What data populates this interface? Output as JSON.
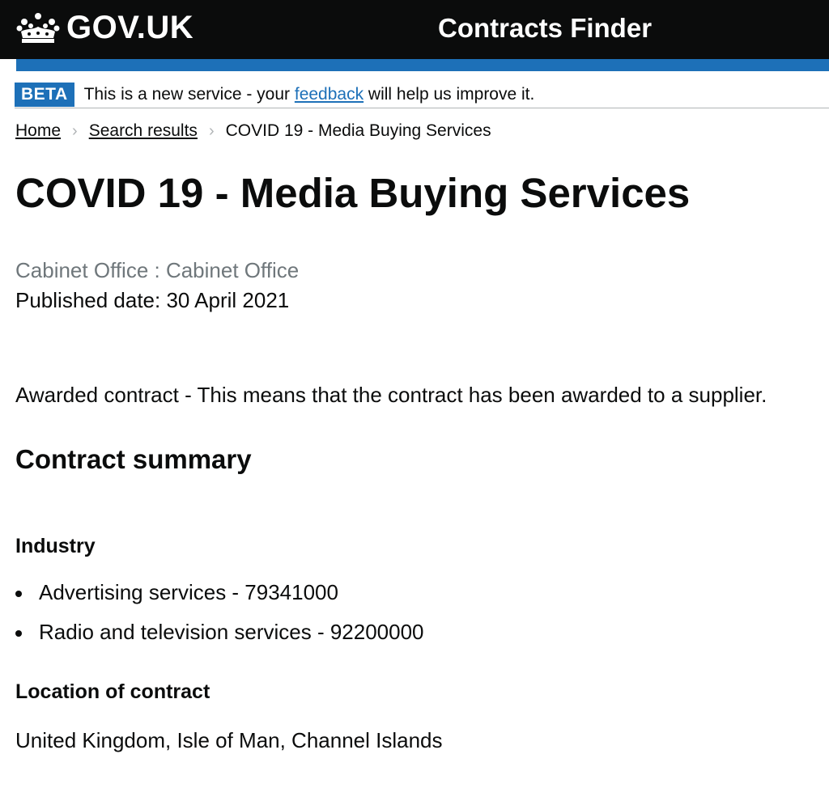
{
  "header": {
    "logo_text": "GOV.UK",
    "service_name": "Contracts Finder",
    "brand_color": "#0b0c0c",
    "accent_color": "#1d70b8",
    "logo_icon": "crown-icon"
  },
  "beta_banner": {
    "tag": "BETA",
    "text_before": "This is a new service - your ",
    "link": "feedback",
    "text_after": " will help us improve it."
  },
  "breadcrumbs": {
    "home": "Home",
    "search_results": "Search results",
    "current": "COVID 19 - Media Buying Services",
    "separator_icon": "chevron-right-icon"
  },
  "page": {
    "title": "COVID 19 - Media Buying Services",
    "organisation": "Cabinet Office : Cabinet Office",
    "published_date": "Published date: 30 April 2021",
    "awarded_notice": "Awarded contract - This means that the contract has been awarded to a supplier."
  },
  "summary": {
    "heading": "Contract summary",
    "industry_heading": "Industry",
    "industry_items": [
      "Advertising services - 79341000",
      "Radio and television services - 92200000"
    ],
    "location_heading": "Location of contract",
    "location": "United Kingdom, Isle of Man, Channel Islands"
  }
}
